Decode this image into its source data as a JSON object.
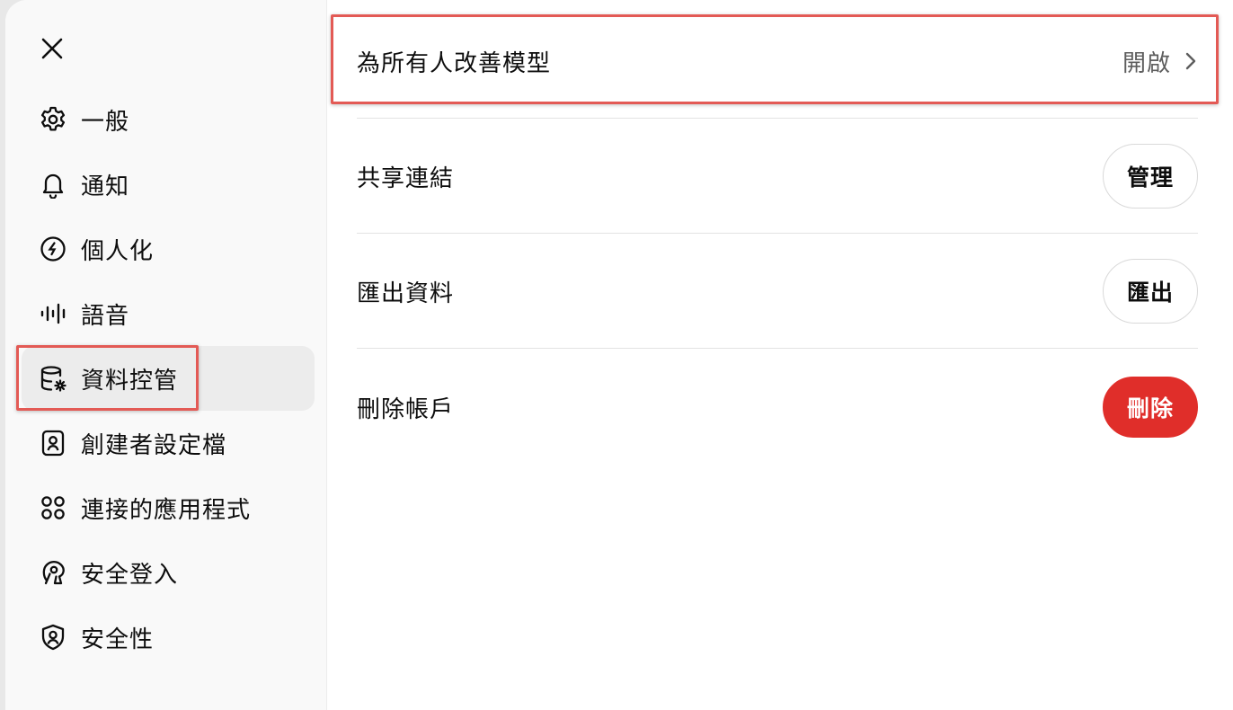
{
  "sidebar": {
    "close_icon": "close-icon",
    "items": [
      {
        "label": "一般",
        "icon": "gear-icon"
      },
      {
        "label": "通知",
        "icon": "bell-icon"
      },
      {
        "label": "個人化",
        "icon": "personalization-icon"
      },
      {
        "label": "語音",
        "icon": "waveform-icon"
      },
      {
        "label": "資料控管",
        "icon": "database-gear-icon",
        "active": true
      },
      {
        "label": "創建者設定檔",
        "icon": "id-badge-icon"
      },
      {
        "label": "連接的應用程式",
        "icon": "apps-icon"
      },
      {
        "label": "安全登入",
        "icon": "keyhole-icon"
      },
      {
        "label": "安全性",
        "icon": "shield-user-icon"
      }
    ]
  },
  "main": {
    "improve_model": {
      "label": "為所有人改善模型",
      "value": "開啟",
      "icon": "chevron-right-icon"
    },
    "shared_links": {
      "label": "共享連結",
      "button": "管理"
    },
    "export_data": {
      "label": "匯出資料",
      "button": "匯出"
    },
    "delete_account": {
      "label": "刪除帳戶",
      "button": "刪除"
    }
  },
  "colors": {
    "highlight": "#e35a55",
    "danger": "#e02e2a",
    "sidebar_bg": "#f9f9f9",
    "active_bg": "#ececec"
  }
}
